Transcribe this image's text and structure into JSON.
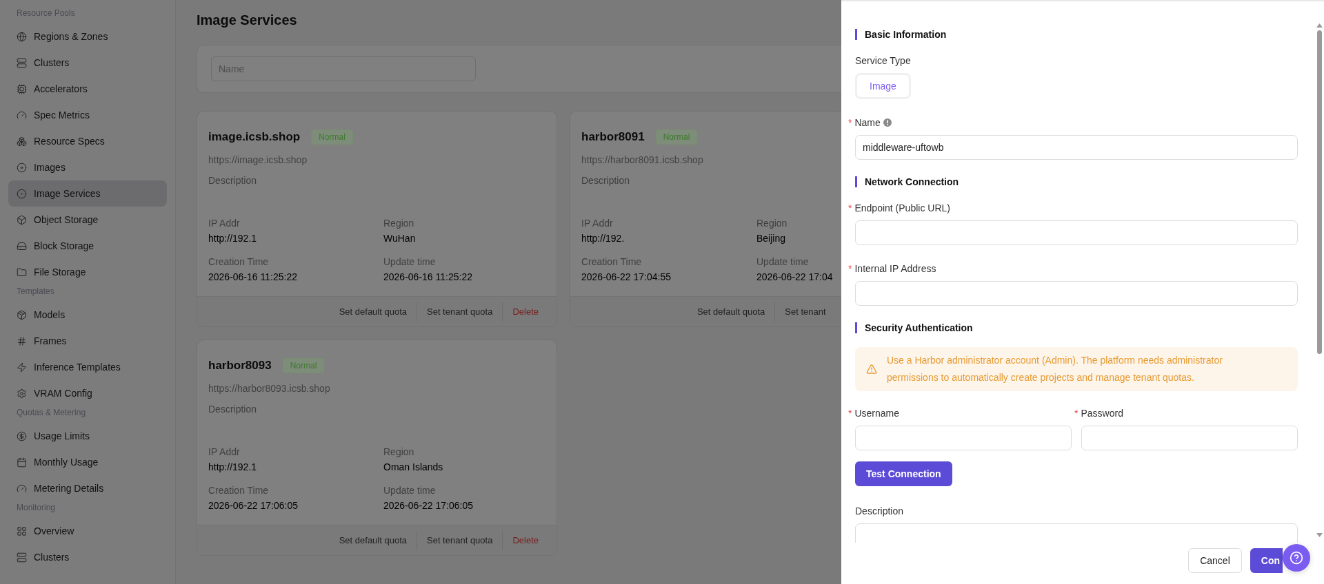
{
  "sidebar": {
    "groups": [
      {
        "label": "Resource Pools",
        "items": [
          {
            "label": "Regions & Zones",
            "selected": false
          },
          {
            "label": "Clusters",
            "selected": false
          },
          {
            "label": "Accelerators",
            "selected": false
          },
          {
            "label": "Spec Metrics",
            "selected": false
          },
          {
            "label": "Resource Specs",
            "selected": false
          },
          {
            "label": "Images",
            "selected": false
          },
          {
            "label": "Image Services",
            "selected": true
          },
          {
            "label": "Object Storage",
            "selected": false
          },
          {
            "label": "Block Storage",
            "selected": false
          },
          {
            "label": "File Storage",
            "selected": false
          }
        ]
      },
      {
        "label": "Templates",
        "items": [
          {
            "label": "Models",
            "selected": false
          },
          {
            "label": "Frames",
            "selected": false
          },
          {
            "label": "Inference Templates",
            "selected": false
          },
          {
            "label": "VRAM Config",
            "selected": false
          }
        ]
      },
      {
        "label": "Quotas & Metering",
        "items": [
          {
            "label": "Usage Limits",
            "selected": false
          },
          {
            "label": "Monthly Usage",
            "selected": false
          },
          {
            "label": "Metering Details",
            "selected": false
          }
        ]
      },
      {
        "label": "Monitoring",
        "items": [
          {
            "label": "Overview",
            "selected": false
          },
          {
            "label": "Clusters",
            "selected": false
          }
        ]
      }
    ]
  },
  "page": {
    "title": "Image Services",
    "search": {
      "placeholder": "Name"
    }
  },
  "cards": [
    {
      "name": "image.icsb.shop",
      "status": "Normal",
      "url": "https://image.icsb.shop",
      "description": "Description",
      "fields": [
        {
          "label": "IP Addr",
          "value": "http://192.1"
        },
        {
          "label": "Region",
          "value": "WuHan"
        },
        {
          "label": "Creation Time",
          "value": "2026-06-16 11:25:22"
        },
        {
          "label": "Update time",
          "value": "2026-06-16 11:25:22"
        }
      ],
      "actions": [
        {
          "label": "Set default quota",
          "kind": "default"
        },
        {
          "label": "Set tenant quota",
          "kind": "default"
        },
        {
          "label": "Delete",
          "kind": "danger"
        }
      ]
    },
    {
      "name": "harbor8091",
      "status": "Normal",
      "url": "https://harbor8091.icsb.shop",
      "description": "Description",
      "fields": [
        {
          "label": "IP Addr",
          "value": "http://192."
        },
        {
          "label": "Region",
          "value": "Beijing"
        },
        {
          "label": "Creation Time",
          "value": "2026-06-22 17:04:55"
        },
        {
          "label": "Update time",
          "value": "2026-06-22 17:04"
        }
      ],
      "actions": [
        {
          "label": "Set default quota",
          "kind": "default"
        },
        {
          "label": "Set tenant",
          "kind": "default"
        }
      ]
    },
    {
      "name": "harbor8093",
      "status": "Normal",
      "url": "https://harbor8093.icsb.shop",
      "description": "Description",
      "fields": [
        {
          "label": "IP Addr",
          "value": "http://192.1"
        },
        {
          "label": "Region",
          "value": "Oman Islands"
        },
        {
          "label": "Creation Time",
          "value": "2026-06-22 17:06:05"
        },
        {
          "label": "Update time",
          "value": "2026-06-22 17:06:05"
        }
      ],
      "actions": [
        {
          "label": "Set default quota",
          "kind": "default"
        },
        {
          "label": "Set tenant quota",
          "kind": "default"
        },
        {
          "label": "Delete",
          "kind": "danger"
        }
      ]
    }
  ],
  "drawer": {
    "sections": [
      {
        "title": "Basic Information",
        "rows": [
          {
            "kind": "choice",
            "label": "Service Type",
            "options": [
              {
                "label": "Image",
                "selected": true
              }
            ]
          },
          {
            "kind": "fields",
            "items": [
              {
                "label": "Name",
                "mark": "*",
                "info": true,
                "value": "middleware-uftowb"
              }
            ]
          }
        ]
      },
      {
        "title": "Network Connection",
        "rows": [
          {
            "kind": "fields",
            "items": [
              {
                "label": "Endpoint (Public URL)",
                "mark": "*"
              }
            ]
          },
          {
            "kind": "fields",
            "items": [
              {
                "label": "Internal IP Address",
                "mark": "*"
              }
            ]
          }
        ]
      },
      {
        "title": "Security Authentication",
        "rows": [
          {
            "kind": "alert",
            "text": "Use a Harbor administrator account (Admin). The platform needs administrator permissions to automatically create projects and manage tenant quotas."
          },
          {
            "kind": "fields",
            "items": [
              {
                "label": "Username",
                "mark": "*"
              },
              {
                "label": "Password",
                "mark": "*"
              }
            ]
          },
          {
            "kind": "button",
            "label": "Test Connection"
          },
          {
            "kind": "textarea",
            "label": "Description"
          }
        ]
      }
    ],
    "footer": {
      "cancel": "Cancel",
      "confirm": "Con"
    }
  }
}
